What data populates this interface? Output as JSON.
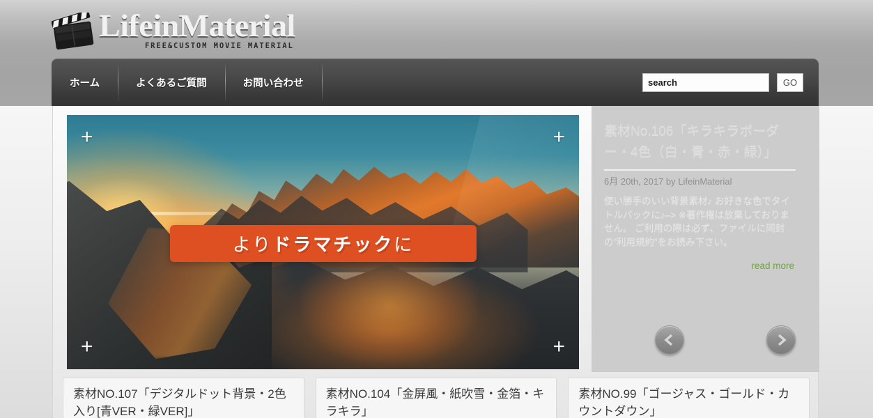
{
  "site": {
    "logo_title": "LifeinMaterial",
    "logo_tagline": "FREE&CUSTOM MOVIE MATERIAL",
    "logo_icon": "clapperboard-icon"
  },
  "nav": {
    "items": [
      {
        "label": "ホーム"
      },
      {
        "label": "よくあるご質問"
      },
      {
        "label": "お問い合わせ"
      }
    ]
  },
  "search": {
    "value": "search",
    "placeholder": "search",
    "button_label": "GO"
  },
  "hero": {
    "banner_prefix": "より",
    "banner_strong": "ドラマチック",
    "banner_suffix": "に",
    "corner_marker": "+",
    "image_alt": "sunrise-mountain-landscape"
  },
  "featured": {
    "title": "素材No.106「キラキラボーダー・4色（白・青・赤・緑）」",
    "date": "6月 20th, 2017 by LifeinMaterial",
    "description": "使い勝手のいい背景素材♪ お好きな色でタイトルバックに♪–> ※著作権は放棄しておりません。 ご利用の際は必ず、ファイルに同封の”利用規約”をお読み下さい。",
    "read_more": "read more"
  },
  "carousel": {
    "prev_label": "prev-arrow-icon",
    "next_label": "next-arrow-icon"
  },
  "thumbnails": [
    {
      "title": "素材NO.107「デジタルドット背景・2色入り[青VER・緑VER]」"
    },
    {
      "title": "素材NO.104「金屏風・紙吹雪・金箔・キラキラ」"
    },
    {
      "title": "素材NO.99「ゴージャス・ゴールド・カウントダウン」"
    }
  ],
  "colors": {
    "accent_orange": "#de4f22",
    "link_green": "#6aa832",
    "panel_gray": "#cccccc",
    "nav_dark": "#3a3a3a"
  }
}
